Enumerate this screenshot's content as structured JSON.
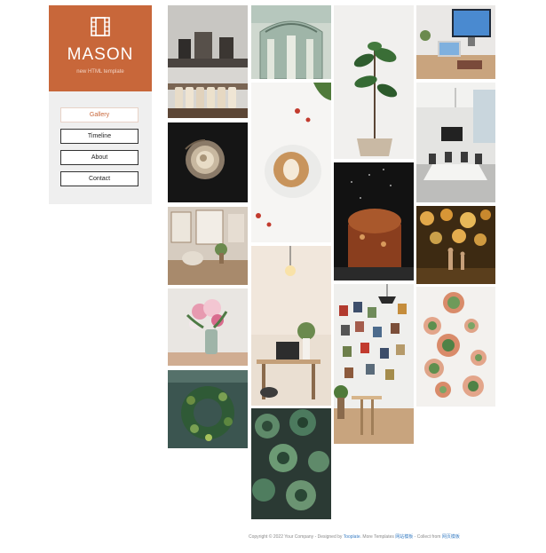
{
  "brand": {
    "title": "MASON",
    "subtitle": "new HTML template",
    "icon": "film-icon",
    "color": "#c8673a"
  },
  "nav": [
    {
      "label": "Gallery",
      "active": true
    },
    {
      "label": "Timeline",
      "active": false
    },
    {
      "label": "About",
      "active": false
    },
    {
      "label": "Contact",
      "active": false
    }
  ],
  "gallery": [
    "coffee bar with jars",
    "building facade",
    "potted tree",
    "laptop on desk",
    "dark rose",
    "latte art coffee",
    "conference room",
    "living room",
    "pastry cake",
    "bokeh lights with figures",
    "pendant lamp",
    "flower vase",
    "workspace with laptop",
    "succulents in pots",
    "wall gallery with chairs",
    "green wreath",
    "succulents closeup"
  ],
  "footer": {
    "text": "Copyright © 2022 Your Company - Designed by ",
    "designer": "Tooplate",
    "mid": ". More Templates ",
    "templates": "网站模板",
    "collect": " - Collect from ",
    "collect_link": "网页模板"
  }
}
